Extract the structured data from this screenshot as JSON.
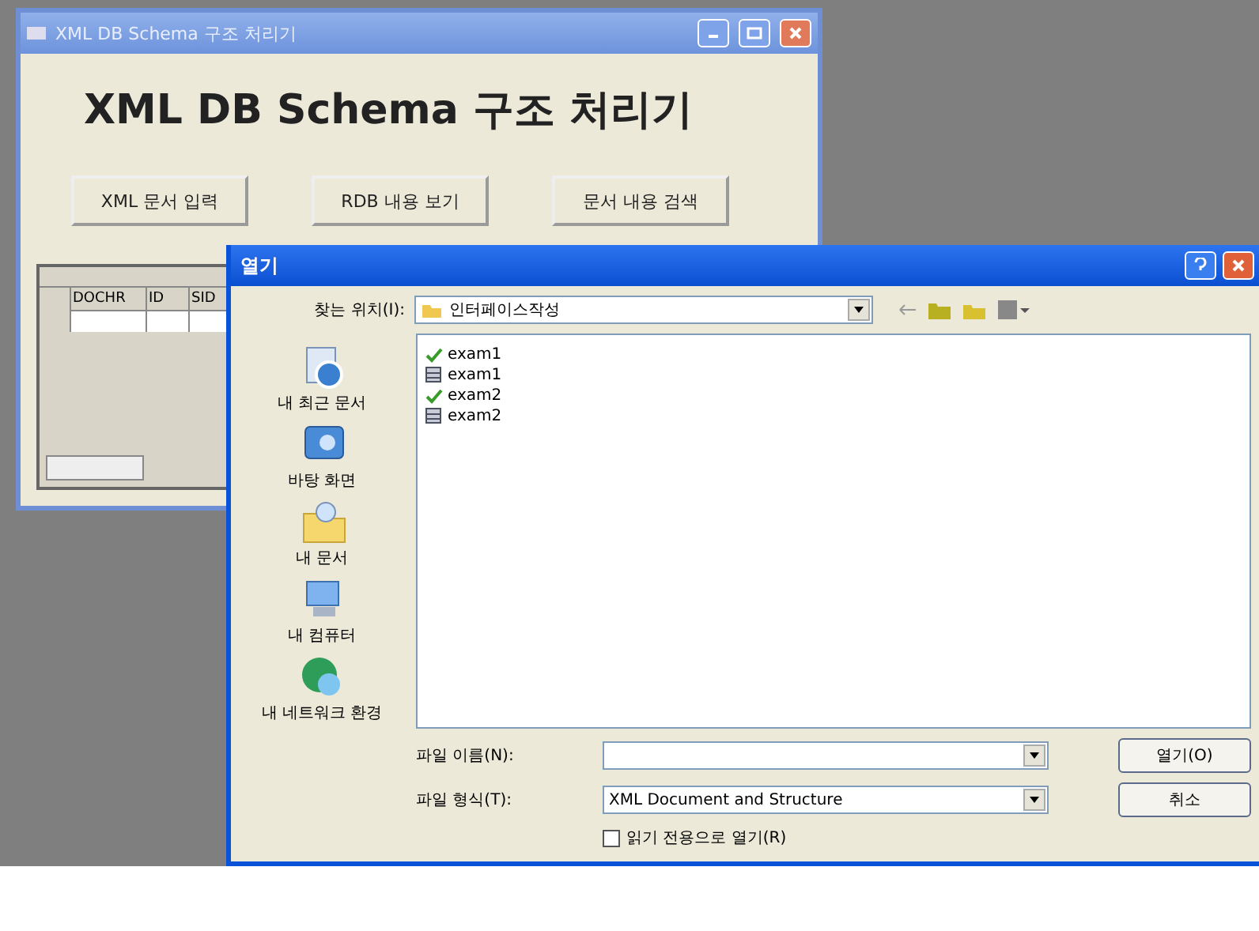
{
  "main_window": {
    "title": "XML DB Schema 구조 처리기",
    "heading": "XML DB Schema 구조 처리기",
    "buttons": [
      "XML 문서 입력",
      "RDB 내용 보기",
      "문서 내용 검색"
    ],
    "grid": {
      "columns": [
        "DOCHR",
        "ID",
        "SID"
      ]
    }
  },
  "open_dialog": {
    "title": "열기",
    "look_in_label": "찾는 위치(I):",
    "look_in_value": "인터페이스작성",
    "places": [
      {
        "label": "내 최근 문서",
        "kind": "recent"
      },
      {
        "label": "바탕 화면",
        "kind": "desktop"
      },
      {
        "label": "내 문서",
        "kind": "documents"
      },
      {
        "label": "내 컴퓨터",
        "kind": "computer"
      },
      {
        "label": "내 네트워크 환경",
        "kind": "network"
      }
    ],
    "files": [
      {
        "name": "exam1",
        "kind": "xml"
      },
      {
        "name": "exam1",
        "kind": "data"
      },
      {
        "name": "exam2",
        "kind": "xml"
      },
      {
        "name": "exam2",
        "kind": "data"
      }
    ],
    "file_name_label": "파일 이름(N):",
    "file_type_label": "파일 형식(T):",
    "file_type_value": "XML Document and Structure",
    "read_only": {
      "label": "읽기 전용으로 열기(R)",
      "checked": false
    },
    "open_button": "열기(O)",
    "cancel_button": "취소"
  }
}
